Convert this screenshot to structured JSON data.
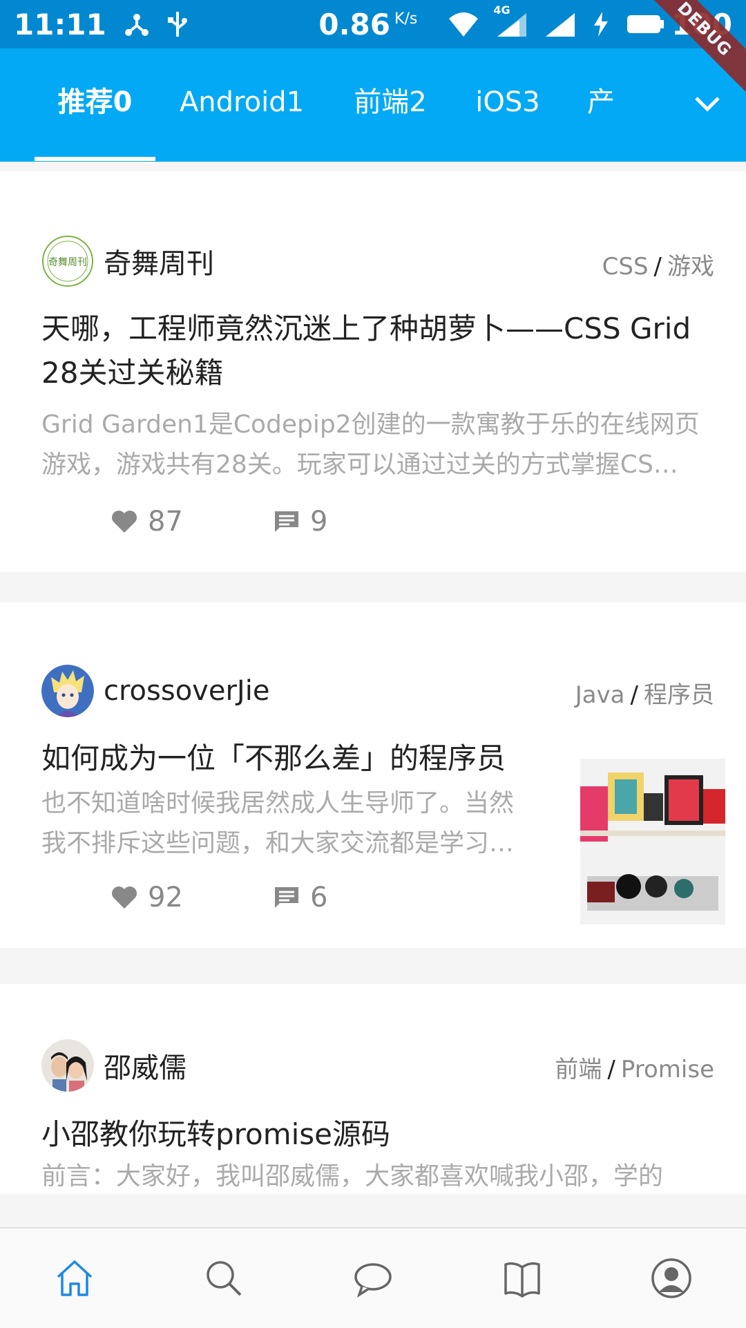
{
  "status_bar": {
    "time": "11:11",
    "network_speed": "0.86",
    "network_unit": "K/s",
    "network_type": "4G",
    "battery": "100",
    "icons": [
      "tree-icon",
      "usb-icon",
      "wifi-icon",
      "cell-signal-icon",
      "cell-signal-icon",
      "charging-icon",
      "battery-icon"
    ]
  },
  "debug_banner": "DEBUG",
  "tabs": [
    {
      "label": "推荐0",
      "active": true
    },
    {
      "label": "Android1"
    },
    {
      "label": "前端2"
    },
    {
      "label": "iOS3"
    },
    {
      "label": "产"
    }
  ],
  "colors": {
    "status_bar": "#0288d1",
    "tab_bar": "#03a9f4",
    "accent": "#1e88e5",
    "text_primary": "#222222",
    "text_secondary": "#8a8a8a",
    "text_summary": "#aaaaaa"
  },
  "articles": [
    {
      "author": "奇舞周刊",
      "avatar_text": "奇舞周刊",
      "category": "CSS",
      "tag": "游戏",
      "title_line1": "天哪，工程师竟然沉迷上了种胡萝卜——CSS Grid",
      "title_line2": "28关过关秘籍",
      "summary_line1": "Grid Garden1是Codepip2创建的一款寓教于乐的在线网页",
      "summary_line2": "游戏，游戏共有28关。玩家可以通过过关的方式掌握CS…",
      "likes": "87",
      "comments": "9"
    },
    {
      "author": "crossoverJie",
      "category": "Java",
      "tag": "程序员",
      "title": "如何成为一位「不那么差」的程序员",
      "summary_line1": "也不知道啥时候我居然成人生导师了。当然",
      "summary_line2": "我不排斥这些问题，和大家交流都是学习…",
      "likes": "92",
      "comments": "6"
    },
    {
      "author": "邵威儒",
      "category": "前端",
      "tag": "Promise",
      "title": "小邵教你玩转promise源码",
      "summary_line1": "前言：大家好，我叫邵威儒，大家都喜欢喊我小邵，学的"
    }
  ],
  "bottom_nav": [
    {
      "icon": "home-icon",
      "active": true
    },
    {
      "icon": "search-icon"
    },
    {
      "icon": "chat-icon"
    },
    {
      "icon": "book-icon"
    },
    {
      "icon": "profile-icon"
    }
  ]
}
